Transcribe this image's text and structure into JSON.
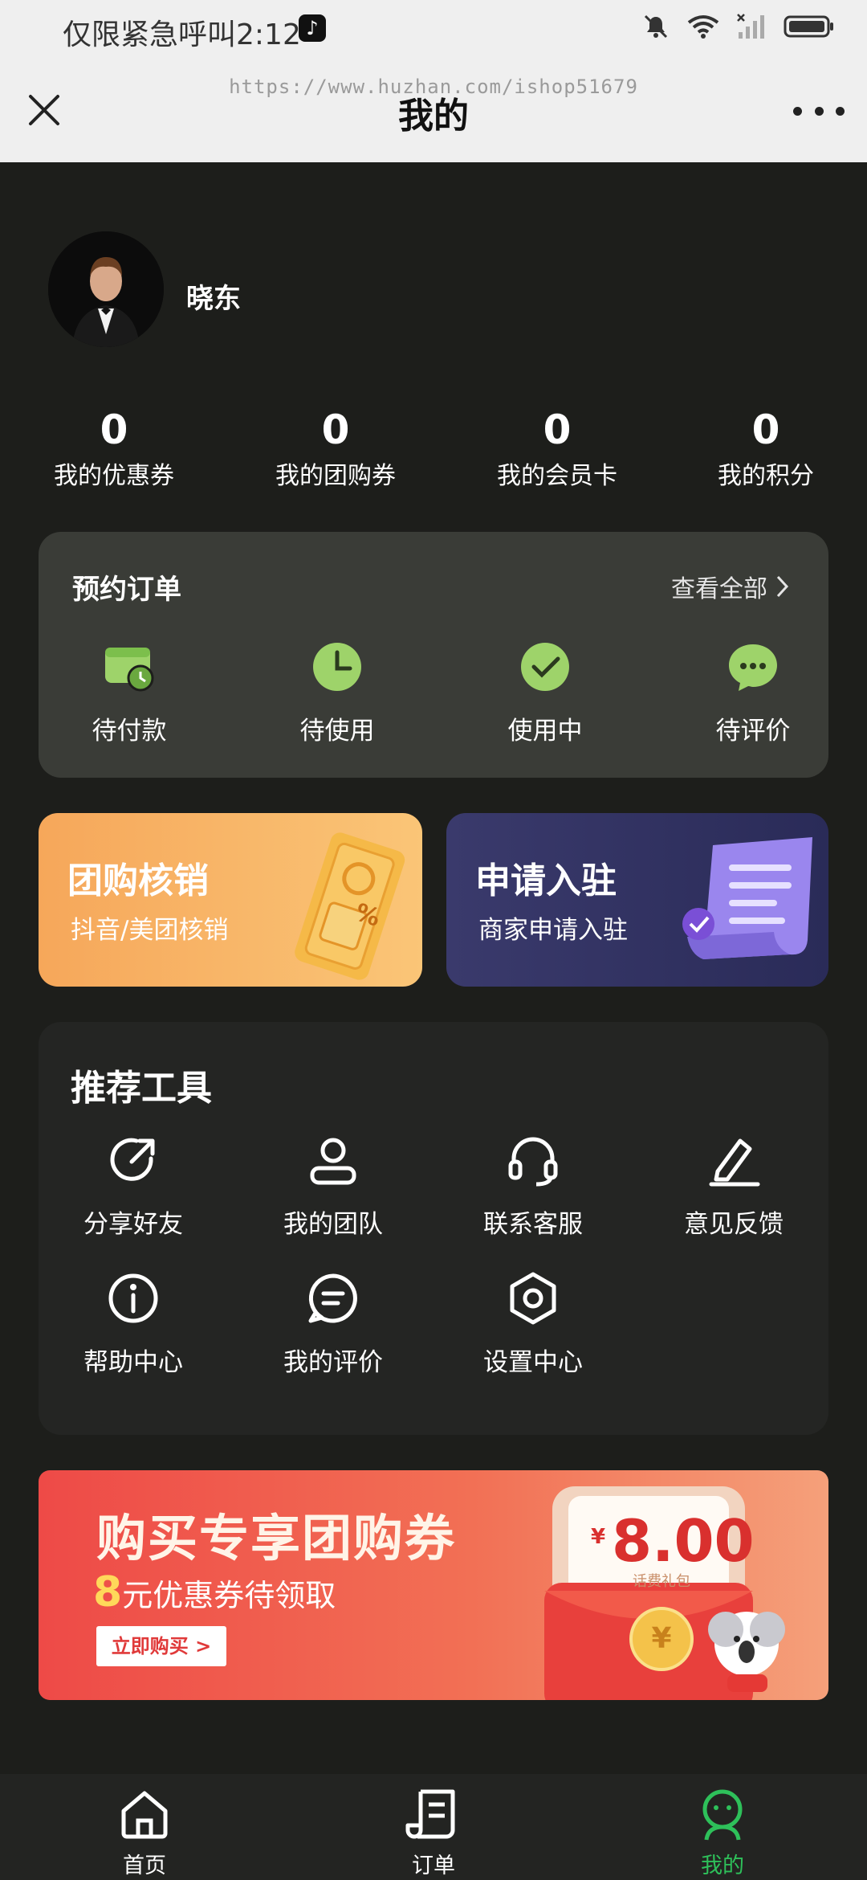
{
  "status_bar": {
    "carrier_text": "仅限紧急呼叫",
    "time": "2:12"
  },
  "header": {
    "title": "我的",
    "watermark": "https://www.huzhan.com/ishop51679"
  },
  "profile": {
    "name": "晓东"
  },
  "stats": [
    {
      "value": "0",
      "label": "我的优惠券"
    },
    {
      "value": "0",
      "label": "我的团购券"
    },
    {
      "value": "0",
      "label": "我的会员卡"
    },
    {
      "value": "0",
      "label": "我的积分"
    }
  ],
  "booking": {
    "title": "预约订单",
    "view_all": "查看全部",
    "items": [
      {
        "label": "待付款",
        "icon": "wallet-clock-icon"
      },
      {
        "label": "待使用",
        "icon": "clock-icon"
      },
      {
        "label": "使用中",
        "icon": "check-icon"
      },
      {
        "label": "待评价",
        "icon": "chat-bubble-icon"
      }
    ]
  },
  "promo_cards": {
    "group_verify": {
      "title": "团购核销",
      "subtitle": "抖音/美团核销",
      "badge": "%"
    },
    "apply_join": {
      "title": "申请入驻",
      "subtitle": "商家申请入驻"
    }
  },
  "tools": {
    "title": "推荐工具",
    "items": [
      {
        "label": "分享好友",
        "icon": "share-icon"
      },
      {
        "label": "我的团队",
        "icon": "person-icon"
      },
      {
        "label": "联系客服",
        "icon": "headset-icon"
      },
      {
        "label": "意见反馈",
        "icon": "edit-icon"
      },
      {
        "label": "帮助中心",
        "icon": "info-icon"
      },
      {
        "label": "我的评价",
        "icon": "comment-icon"
      },
      {
        "label": "设置中心",
        "icon": "settings-icon"
      }
    ]
  },
  "banner": {
    "title": "购买专享团购券",
    "subtitle_number": "8",
    "subtitle_rest": "元优惠券待领取",
    "button": "立即购买 >",
    "currency": "¥",
    "amount": "8.00",
    "envelope_caption": "话费礼包",
    "coin": "¥"
  },
  "tabbar": {
    "items": [
      {
        "label": "首页",
        "icon": "home-icon"
      },
      {
        "label": "订单",
        "icon": "order-icon"
      },
      {
        "label": "我的",
        "icon": "profile-icon"
      }
    ],
    "active_color": "#2ec05a",
    "inactive_color": "#ffffff"
  },
  "colors": {
    "background": "#1d1e1b",
    "accent_green": "#2ec05a",
    "icon_green": "#8fd35a"
  }
}
